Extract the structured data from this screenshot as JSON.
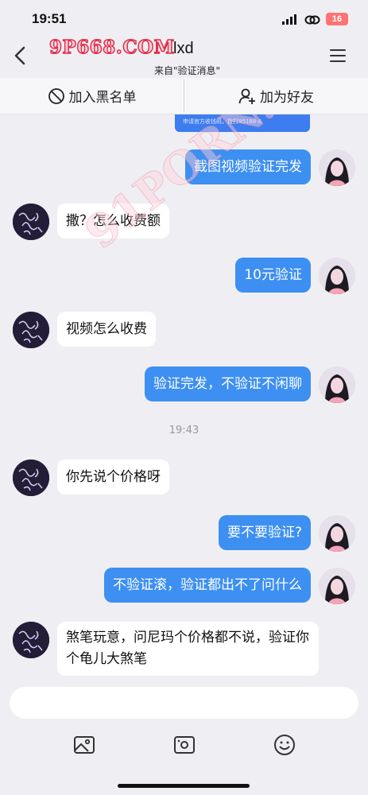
{
  "status": {
    "time": "19:51",
    "battery": "16"
  },
  "header": {
    "logo": "9P668.COM",
    "name": "lxd",
    "subtitle": "来自\"验证消息\""
  },
  "actions": {
    "block": "加入黑名单",
    "add_friend": "加为好友"
  },
  "note": "申请官方收钱码，拨打95188-6",
  "watermark": "91PORN.COM",
  "messages": [
    {
      "side": "out",
      "text": "截图视频验证完发"
    },
    {
      "side": "in",
      "text": "撒？怎么收费额"
    },
    {
      "side": "out",
      "text": "10元验证"
    },
    {
      "side": "in",
      "text": "视频怎么收费"
    },
    {
      "side": "out",
      "text": "验证完发，不验证不闲聊"
    },
    {
      "side": "time",
      "text": "19:43"
    },
    {
      "side": "in",
      "text": "你先说个价格呀"
    },
    {
      "side": "out",
      "text": "要不要验证?"
    },
    {
      "side": "out",
      "text": "不验证滚，验证都出不了问什么"
    },
    {
      "side": "in",
      "text": "煞笔玩意，问尼玛个价格都不说，验证你个龟儿大煞笔"
    }
  ],
  "toolbar": [
    "image-icon",
    "video-icon",
    "emoji-icon"
  ],
  "colors": {
    "out_bubble": "#3d8ff2",
    "in_bubble": "#ffffff",
    "background": "#efeff3"
  }
}
